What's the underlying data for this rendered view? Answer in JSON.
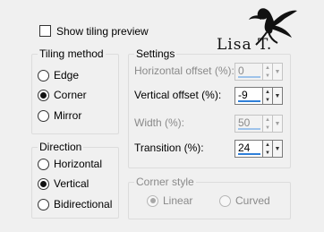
{
  "show_tiling_preview": {
    "label": "Show tiling preview",
    "checked": false
  },
  "watermark": {
    "text": "Lisa T."
  },
  "tiling_method": {
    "title": "Tiling method",
    "options": [
      {
        "label": "Edge",
        "selected": false
      },
      {
        "label": "Corner",
        "selected": true
      },
      {
        "label": "Mirror",
        "selected": false
      }
    ]
  },
  "direction": {
    "title": "Direction",
    "options": [
      {
        "label": "Horizontal",
        "selected": false
      },
      {
        "label": "Vertical",
        "selected": true
      },
      {
        "label": "Bidirectional",
        "selected": false
      }
    ]
  },
  "settings": {
    "title": "Settings",
    "fields": [
      {
        "label": "Horizontal offset (%):",
        "value": "0",
        "enabled": false
      },
      {
        "label": "Vertical offset (%):",
        "value": "-9",
        "enabled": true
      },
      {
        "label": "Width (%):",
        "value": "50",
        "enabled": false
      },
      {
        "label": "Transition (%):",
        "value": "24",
        "enabled": true
      }
    ]
  },
  "corner_style": {
    "title": "Corner style",
    "enabled": false,
    "options": [
      {
        "label": "Linear",
        "selected": true
      },
      {
        "label": "Curved",
        "selected": false
      }
    ]
  },
  "colors": {
    "accent": "#2f7fd8",
    "background": "#f0f0f0",
    "disabled_text": "#8a8a8a"
  }
}
